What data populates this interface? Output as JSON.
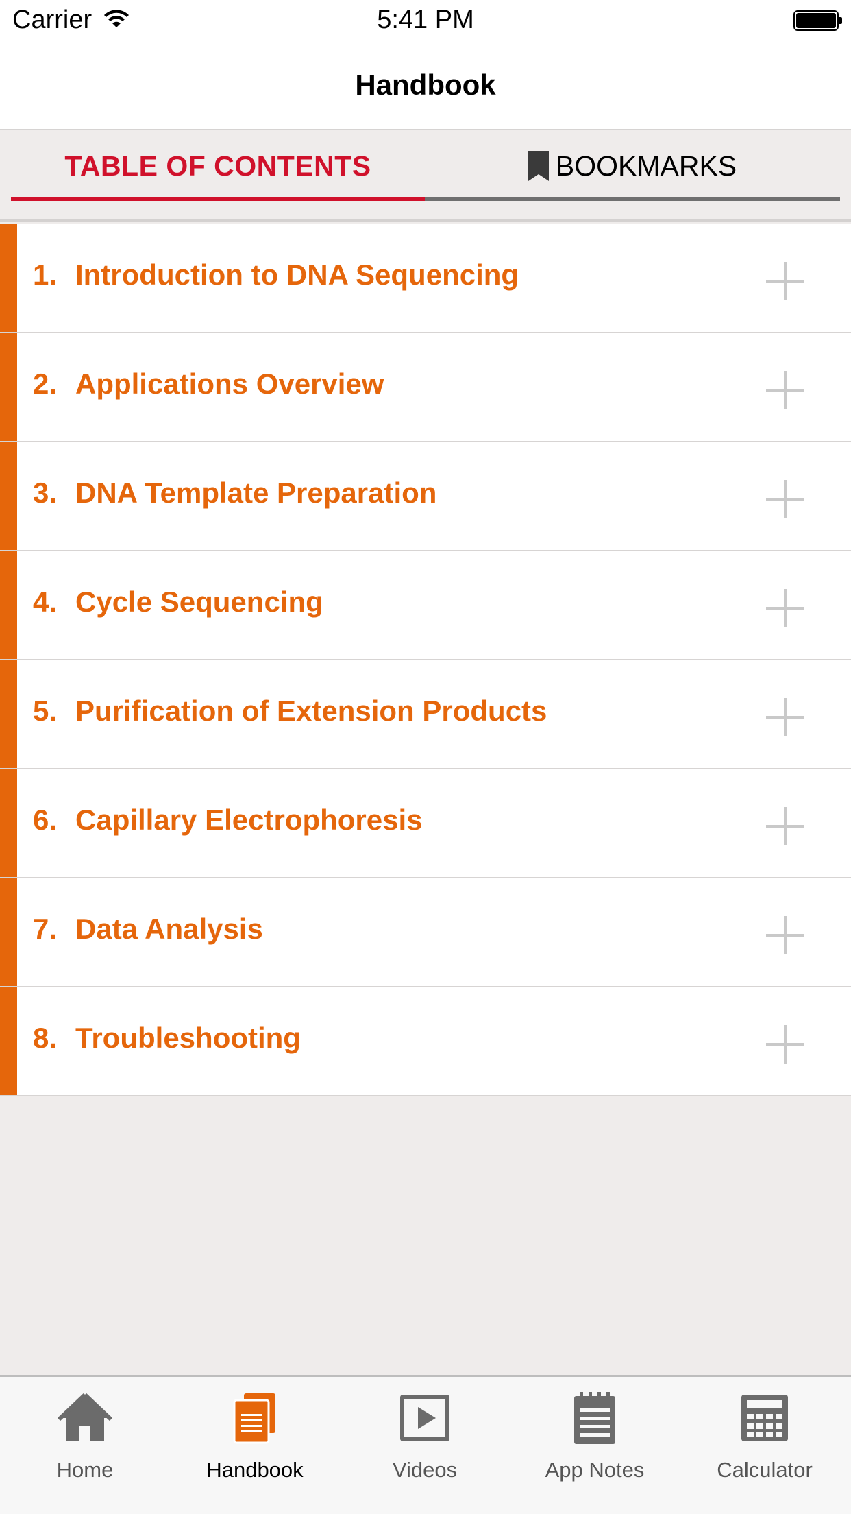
{
  "status_bar": {
    "carrier": "Carrier",
    "time": "5:41 PM"
  },
  "nav": {
    "title": "Handbook"
  },
  "tabs": {
    "table_of_contents": "TABLE OF CONTENTS",
    "bookmarks": "BOOKMARKS",
    "active": "table_of_contents"
  },
  "toc": [
    {
      "number": "1.",
      "title": "Introduction to DNA Sequencing"
    },
    {
      "number": "2.",
      "title": "Applications Overview"
    },
    {
      "number": "3.",
      "title": "DNA Template Preparation"
    },
    {
      "number": "4.",
      "title": "Cycle Sequencing"
    },
    {
      "number": "5.",
      "title": "Purification of Extension Products"
    },
    {
      "number": "6.",
      "title": "Capillary Electrophoresis"
    },
    {
      "number": "7.",
      "title": "Data Analysis"
    },
    {
      "number": "8.",
      "title": "Troubleshooting"
    }
  ],
  "tab_bar": [
    {
      "label": "Home",
      "icon": "home-icon"
    },
    {
      "label": "Handbook",
      "icon": "handbook-icon",
      "active": true
    },
    {
      "label": "Videos",
      "icon": "video-play-icon"
    },
    {
      "label": "App Notes",
      "icon": "notepad-icon"
    },
    {
      "label": "Calculator",
      "icon": "calculator-icon"
    }
  ],
  "colors": {
    "accent_orange": "#e5660b",
    "active_red": "#d0112b",
    "icon_gray": "#6b6b6b",
    "background": "#efeceb"
  }
}
